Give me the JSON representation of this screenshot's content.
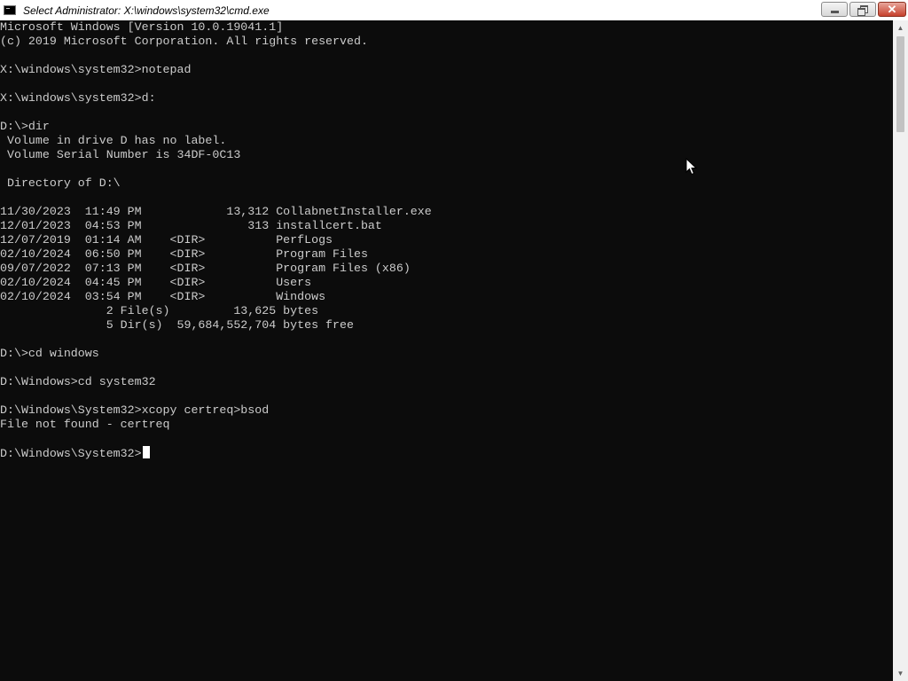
{
  "window": {
    "title": "Select Administrator: X:\\windows\\system32\\cmd.exe",
    "controls": {
      "minimize_icon": "minimize-icon",
      "maximize_icon": "restore-icon",
      "close_icon": "close-icon",
      "close_glyph": "✕"
    }
  },
  "console": {
    "background": "#0c0c0c",
    "foreground": "#cccccc",
    "lines": [
      "Microsoft Windows [Version 10.0.19041.1]",
      "(c) 2019 Microsoft Corporation. All rights reserved.",
      "",
      "X:\\windows\\system32>notepad",
      "",
      "X:\\windows\\system32>d:",
      "",
      "D:\\>dir",
      " Volume in drive D has no label.",
      " Volume Serial Number is 34DF-0C13",
      "",
      " Directory of D:\\",
      "",
      "11/30/2023  11:49 PM            13,312 CollabnetInstaller.exe",
      "12/01/2023  04:53 PM               313 installcert.bat",
      "12/07/2019  01:14 AM    <DIR>          PerfLogs",
      "02/10/2024  06:50 PM    <DIR>          Program Files",
      "09/07/2022  07:13 PM    <DIR>          Program Files (x86)",
      "02/10/2024  04:45 PM    <DIR>          Users",
      "02/10/2024  03:54 PM    <DIR>          Windows",
      "               2 File(s)         13,625 bytes",
      "               5 Dir(s)  59,684,552,704 bytes free",
      "",
      "D:\\>cd windows",
      "",
      "D:\\Windows>cd system32",
      "",
      "D:\\Windows\\System32>xcopy certreq>bsod",
      "File not found - certreq",
      ""
    ],
    "prompt": "D:\\Windows\\System32>"
  }
}
